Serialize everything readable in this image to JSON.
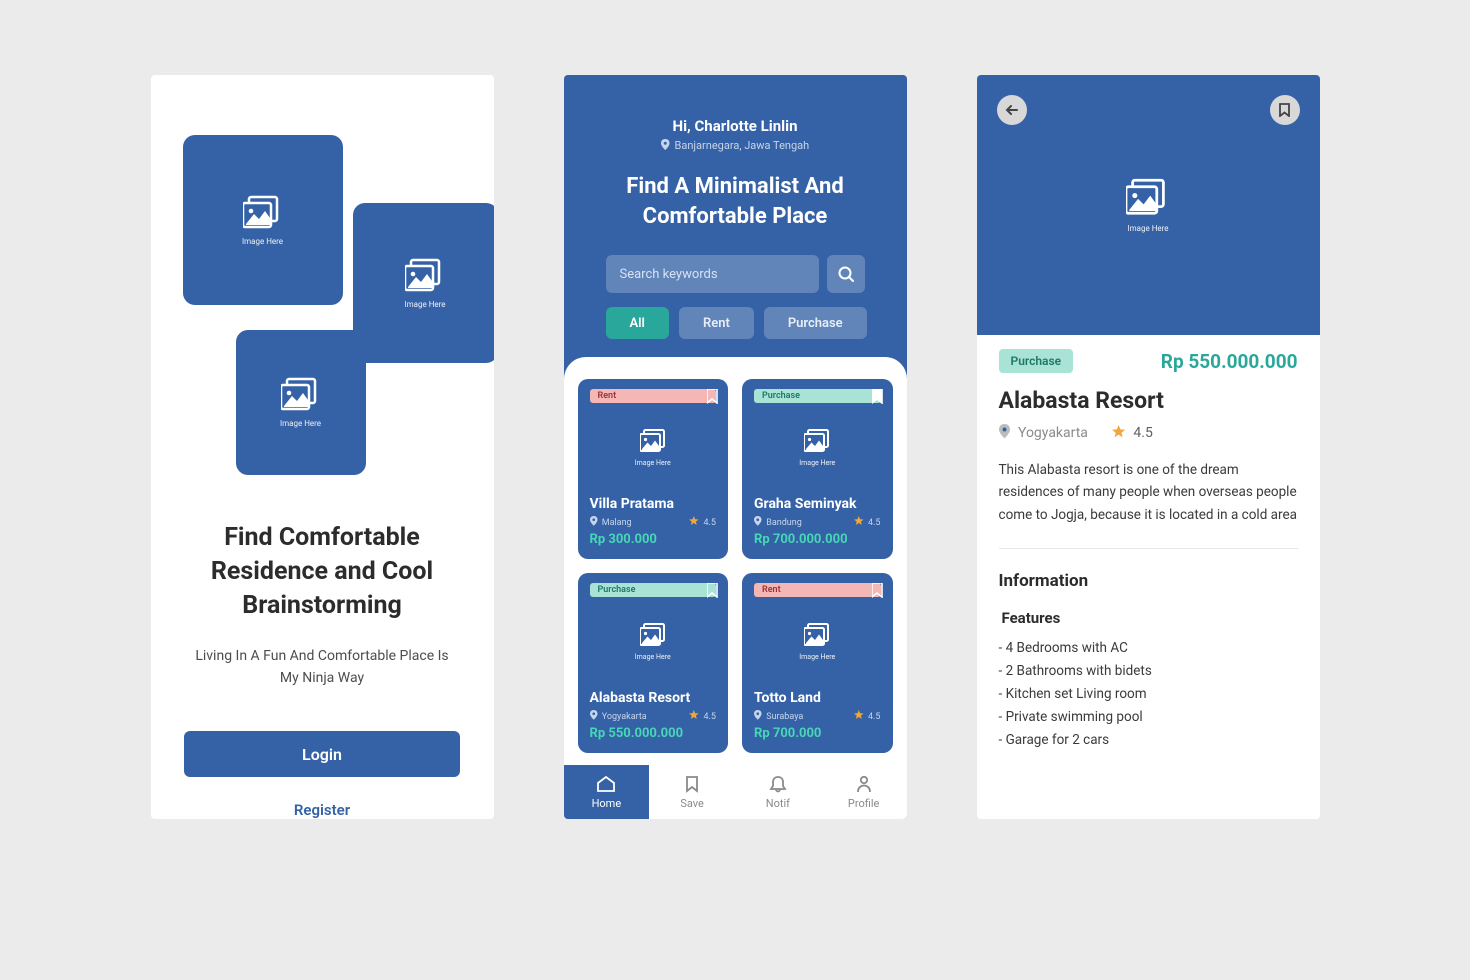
{
  "image_placeholder_label": "Image Here",
  "onboarding": {
    "title": "Find Comfortable Residence and Cool Brainstorming",
    "subtitle": "Living In A Fun And Comfortable Place Is My Ninja Way",
    "login_label": "Login",
    "register_label": "Register"
  },
  "home": {
    "greeting": "Hi, Charlotte Linlin",
    "location": "Banjarnegara, Jawa Tengah",
    "hero": "Find A Minimalist And Comfortable Place",
    "search_placeholder": "Search keywords",
    "filters": {
      "all": "All",
      "rent": "Rent",
      "purchase": "Purchase"
    },
    "tag": {
      "rent": "Rent",
      "purchase": "Purchase"
    },
    "cards": [
      {
        "type": "rent",
        "name": "Villa Pratama",
        "loc": "Malang",
        "rating": "4.5",
        "price": "Rp 300.000"
      },
      {
        "type": "purchase",
        "name": "Graha Seminyak",
        "loc": "Bandung",
        "rating": "4.5",
        "price": "Rp 700.000.000"
      },
      {
        "type": "purchase",
        "name": "Alabasta Resort",
        "loc": "Yogyakarta",
        "rating": "4.5",
        "price": "Rp 550.000.000"
      },
      {
        "type": "rent",
        "name": "Totto Land",
        "loc": "Surabaya",
        "rating": "4.5",
        "price": "Rp 700.000"
      }
    ],
    "nav": {
      "home": "Home",
      "save": "Save",
      "notif": "Notif",
      "profile": "Profile"
    }
  },
  "detail": {
    "tag": "Purchase",
    "price": "Rp 550.000.000",
    "title": "Alabasta Resort",
    "location": "Yogyakarta",
    "rating": "4.5",
    "description": "This Alabasta resort is one of the dream residences of many people when overseas people come to Jogja, because it is located in a cold area",
    "info_heading": "Information",
    "features_heading": "Features",
    "features": [
      "4 Bedrooms with AC",
      "2 Bathrooms with bidets",
      "Kitchen set Living room",
      "Private swimming pool",
      "Garage for 2 cars"
    ]
  }
}
